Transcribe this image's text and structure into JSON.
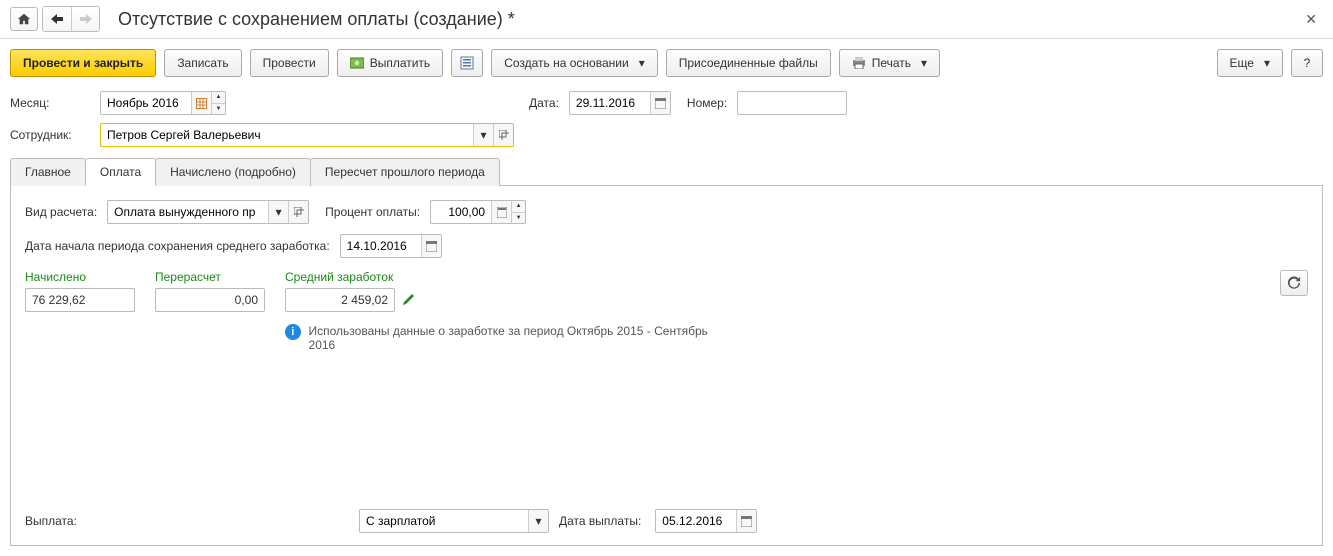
{
  "header": {
    "title": "Отсутствие с сохранением оплаты (создание) *"
  },
  "toolbar": {
    "post_close": "Провести и закрыть",
    "write": "Записать",
    "post": "Провести",
    "pay": "Выплатить",
    "create_based": "Создать на основании",
    "attachments": "Присоединенные файлы",
    "print": "Печать",
    "more": "Еще",
    "help": "?"
  },
  "fields": {
    "month_label": "Месяц:",
    "month_value": "Ноябрь 2016",
    "date_label": "Дата:",
    "date_value": "29.11.2016",
    "number_label": "Номер:",
    "number_value": "",
    "employee_label": "Сотрудник:",
    "employee_value": "Петров Сергей Валерьевич"
  },
  "tabs": {
    "main": "Главное",
    "payment": "Оплата",
    "accrued": "Начислено (подробно)",
    "recalc": "Пересчет прошлого периода"
  },
  "payment_tab": {
    "calc_type_label": "Вид расчета:",
    "calc_type_value": "Оплата вынужденного пр",
    "percent_label": "Процент оплаты:",
    "percent_value": "100,00",
    "period_start_label": "Дата начала периода сохранения среднего заработка:",
    "period_start_value": "14.10.2016",
    "accrued_label": "Начислено",
    "accrued_value": "76 229,62",
    "recalc_label": "Перерасчет",
    "recalc_value": "0,00",
    "avg_earn_label": "Средний заработок",
    "avg_earn_value": "2 459,02",
    "info_text": "Использованы данные о заработке за период Октябрь 2015 - Сентябрь 2016"
  },
  "footer": {
    "payout_label": "Выплата:",
    "payout_value": "С зарплатой",
    "payout_date_label": "Дата выплаты:",
    "payout_date_value": "05.12.2016"
  }
}
